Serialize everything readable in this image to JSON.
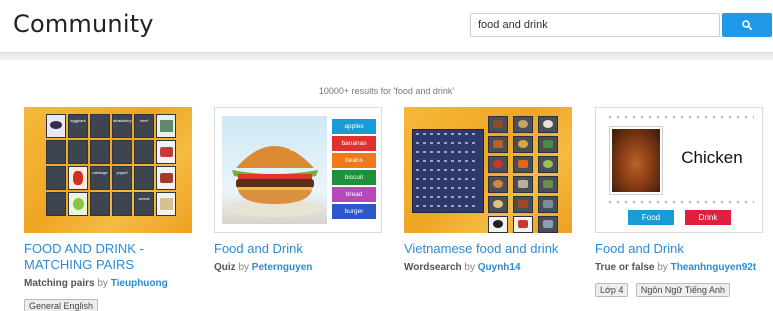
{
  "header": {
    "title": "Community",
    "search_value": "food and drink",
    "search_button_icon": "search-icon"
  },
  "results": {
    "summary": "10000+ results for 'food and drink'"
  },
  "cards": [
    {
      "title": "FOOD AND DRINK - MATCHING PAIRS",
      "type": "Matching pairs",
      "by": "by",
      "author": "Tieuphuong",
      "tags": [
        "General English"
      ],
      "thumb_words": [
        "eggplant",
        "strawberry",
        "beef",
        "cabbage",
        "yogurt",
        "cereal"
      ]
    },
    {
      "title": "Food and Drink",
      "type": "Quiz",
      "by": "by",
      "author": "Peternguyen",
      "tags": [],
      "thumb_words": [
        "apples",
        "bananas",
        "beans",
        "biscuit",
        "bread",
        "burger"
      ]
    },
    {
      "title": "Vietnamese food and drink",
      "type": "Wordsearch",
      "by": "by",
      "author": "Quynh14",
      "tags": []
    },
    {
      "title": "Food and Drink",
      "type": "True or false",
      "by": "by",
      "author": "Theanhnguyen92t",
      "tags": [
        "Lớp 4",
        "Ngôn Ngữ Tiếng Anh"
      ],
      "thumb_word": "Chicken",
      "thumb_buttons": [
        "Food",
        "Drink"
      ]
    }
  ],
  "colors": {
    "accent": "#1e9ae8",
    "link": "#2b8bd6",
    "thumb_orange": "#f0a524",
    "word_colors": [
      "#1a9bd7",
      "#e0312f",
      "#f07a1a",
      "#1f8f3a",
      "#b44ab7",
      "#2d57c9"
    ],
    "tf_food": "#1a9bd7",
    "tf_drink": "#e0203f"
  }
}
